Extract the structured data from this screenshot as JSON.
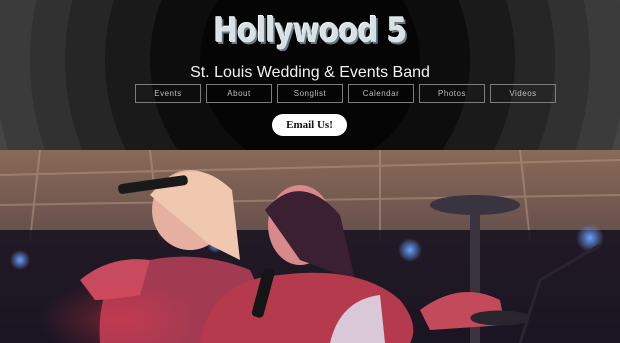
{
  "site": {
    "logo_text": "Hollywood 5",
    "tagline": "St. Louis Wedding & Events Band"
  },
  "nav": {
    "items": [
      {
        "label": "Events"
      },
      {
        "label": "About"
      },
      {
        "label": "Songlist"
      },
      {
        "label": "Calendar"
      },
      {
        "label": "Photos"
      },
      {
        "label": "Videos"
      }
    ]
  },
  "cta": {
    "email_label": "Email Us!"
  },
  "hero": {
    "image": "band-singers-stage-photo"
  },
  "colors": {
    "background": "#000000",
    "logo": "#d7e1e6",
    "nav_border": "#7d7d7d",
    "button_bg": "#ffffff",
    "stage_light_red": "#d2323c",
    "stage_light_blue": "#3c78ff"
  }
}
